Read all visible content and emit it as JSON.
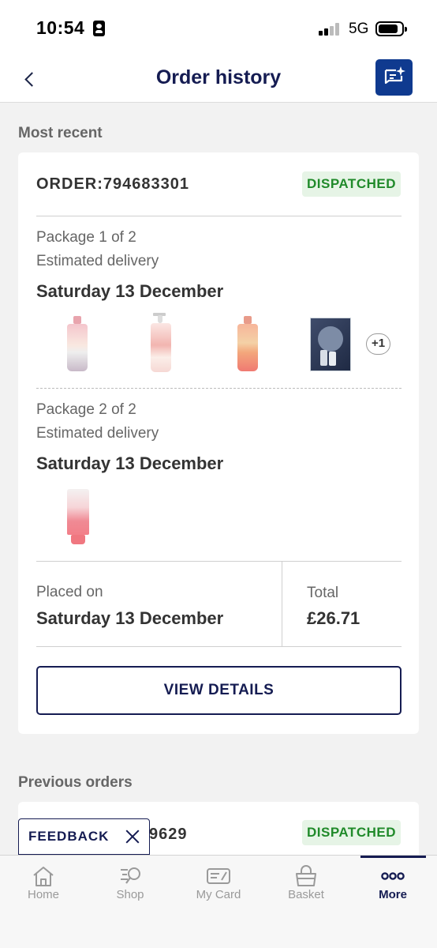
{
  "status_bar": {
    "time": "10:54",
    "network": "5G",
    "icons": [
      "contact-card-icon",
      "signal-icon",
      "battery-icon"
    ]
  },
  "header": {
    "title": "Order history",
    "back_icon": "chevron-left-icon",
    "chat_icon": "chat-sparkle-icon"
  },
  "most_recent": {
    "label": "Most recent",
    "order": {
      "id": "ORDER:794683301",
      "status": "DISPATCHED",
      "packages": [
        {
          "title": "Package 1 of 2",
          "estimated_label": "Estimated delivery",
          "delivery_date": "Saturday 13 December",
          "products": [
            "pink-body-wash-bottle",
            "pump-lotion-bottle",
            "orange-body-wash-bottle",
            "mens-gift-set-box"
          ],
          "more_count": "+1"
        },
        {
          "title": "Package 2 of 2",
          "estimated_label": "Estimated delivery",
          "delivery_date": "Saturday 13 December",
          "products": [
            "pink-tube"
          ]
        }
      ],
      "placed_label": "Placed on",
      "placed_date": "Saturday 13 December",
      "total_label": "Total",
      "total_value": "£26.71",
      "view_details": "VIEW DETAILS"
    }
  },
  "previous": {
    "label": "Previous orders",
    "order": {
      "id_partial": "9629",
      "status": "DISPATCHED"
    }
  },
  "feedback": {
    "label": "FEEDBACK",
    "close_icon": "close-icon"
  },
  "tabbar": {
    "tabs": [
      {
        "label": "Home",
        "icon": "home-icon"
      },
      {
        "label": "Shop",
        "icon": "shop-search-icon"
      },
      {
        "label": "My Card",
        "icon": "loyalty-card-icon"
      },
      {
        "label": "Basket",
        "icon": "basket-icon"
      },
      {
        "label": "More",
        "icon": "more-dots-icon"
      }
    ],
    "active": "More"
  },
  "colors": {
    "navy": "#151c52",
    "dispatched_text": "#208a2a",
    "dispatched_bg": "#e6f4e6",
    "chat_button": "#0f3a8f"
  }
}
